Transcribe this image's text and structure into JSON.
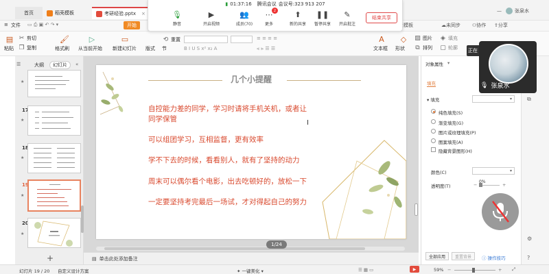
{
  "tabs": {
    "home": "首页",
    "template": "稻壳模板",
    "document": "考研经验.pptx"
  },
  "meeting": {
    "timer": "01:37:16",
    "app_name": "腾讯会议",
    "meeting_id_label": "会议号:",
    "meeting_id": "323 913 207",
    "buttons": [
      {
        "label": "静音",
        "icon": "mic-icon"
      },
      {
        "label": "开启视频",
        "icon": "camera-icon"
      },
      {
        "label": "成员(70)",
        "icon": "members-icon"
      },
      {
        "label": "更多",
        "icon": "more-icon",
        "badge": "2"
      },
      {
        "label": "新的共享",
        "icon": "share-icon"
      },
      {
        "label": "暂停共享",
        "icon": "pause-icon"
      },
      {
        "label": "开启批注",
        "icon": "annotate-icon"
      }
    ],
    "end_share": "结束共享"
  },
  "window": {
    "user": "张泉水"
  },
  "menu": {
    "file": "文件",
    "start": "开始",
    "search": "搜索模板",
    "unsync": "未同步",
    "collab": "协作",
    "share": "分享"
  },
  "ribbon": {
    "cut": "剪切",
    "copy": "复制",
    "format_painter": "格式刷",
    "paste": "粘贴",
    "play_from_current": "从当前开始",
    "new_slide": "新建幻灯片",
    "layout": "版式",
    "section": "节",
    "reset": "重置",
    "picture": "图片",
    "fill": "填充",
    "textbox": "文本框",
    "shape": "形状",
    "arrange": "排列",
    "outline": "轮廓"
  },
  "left_panel": {
    "tab_outline": "大纲",
    "tab_slides": "幻灯片",
    "slide_numbers": [
      "17",
      "18",
      "19",
      "20"
    ],
    "add": "+"
  },
  "slide": {
    "title": "几个小提醒",
    "tips": [
      "自控能力差的同学，学习时请将手机关机，或者让同学保管",
      "可以组团学习，互相监督，更有效率",
      "学不下去的时候，看看别人，就有了坚持的动力",
      "周末可以偶尔看个电影，出去吃顿好的，放松一下",
      "一定要坚持考完最后一场试，才对得起自己的努力"
    ],
    "tip1_line1": "自控能力差的同学，学习时请将手机关机，或者让",
    "tip1_line2": "同学保管",
    "page_indicator": "1/24"
  },
  "notes": {
    "placeholder": "单击此处添加备注"
  },
  "properties": {
    "header": "对象属性",
    "tab_fill": "填充",
    "section_fill": "填充",
    "options": [
      "纯色填充(S)",
      "渐变填充(G)",
      "图片或纹理填充(P)",
      "图案填充(A)"
    ],
    "selected_option": 0,
    "hide_bg": "隐藏背景图形(H)",
    "color_label": "颜色(C)",
    "transparency_label": "透明度(T)",
    "transparency_value": "0%",
    "apply_all": "全部应用",
    "reset_bg": "重置背景",
    "tips_link": "操作技巧"
  },
  "video": {
    "name": "张泉水",
    "status_short": "正在"
  },
  "status_bar": {
    "slide_pos": "幻灯片 19 / 20",
    "theme": "自定义设计方案",
    "beautify": "一键美化",
    "zoom": "59%"
  },
  "colors": {
    "accent_orange": "#f08a24",
    "tip_red": "#d94a2f",
    "end_share_red": "#e04848"
  }
}
